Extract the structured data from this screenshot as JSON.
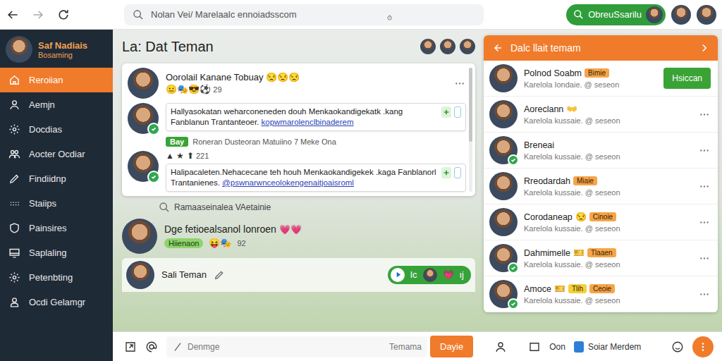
{
  "browser": {
    "address": "Nolan Vei/ Marelaalc ennoiadsscom",
    "action": "ObreuSsarilu"
  },
  "sidebar": {
    "user": {
      "name": "Saf Nadiais",
      "status": "Bosaming"
    },
    "items": [
      {
        "label": "Reroiian",
        "selected": true
      },
      {
        "label": "Aemjn",
        "selected": false
      },
      {
        "label": "Docdias",
        "selected": false
      },
      {
        "label": "Aocter Ocdiar",
        "selected": false
      },
      {
        "label": "Findiidnp",
        "selected": false
      },
      {
        "label": "Staiips",
        "selected": false
      },
      {
        "label": "Painsires",
        "selected": false
      },
      {
        "label": "Saplaling",
        "selected": false
      },
      {
        "label": "Petenbting",
        "selected": false
      },
      {
        "label": "Ocdi Gelamgr",
        "selected": false
      }
    ]
  },
  "feed": {
    "title": "La: Dat Teman",
    "thread": {
      "author": "Oorolail Kanane Tobuay",
      "author_emoji": "😒😒😒",
      "reactions": "😐🎭😎⚽",
      "reaction_count": "29",
      "messages": [
        {
          "online": true,
          "text": "Hallyasokatan weharconeneden douh Menkaokandigekatk .kang Fanblanun Trantanteoer.",
          "link": "kopwmarolenclbinaderem",
          "note": {
            "tag": "Bay",
            "text": "Roneran Dusteoran Matuiino 7 Meke Ona"
          }
        },
        {
          "online": true,
          "symbols": "▲ ★ ⬆",
          "count": "221",
          "text": "Halipacaleten.Nehacecane teh houh Menkaokandigekek .kaga Fanblanorl Trantanienes.",
          "link": "@pswnarwnceolokengenaitjoaisroml"
        }
      ]
    },
    "search_hint": "Ramaaseinalea VAetainie",
    "posts": [
      {
        "title": "Dge fetioealsanol lonroen",
        "emoji": "💗💗",
        "tag": "Hiienaon",
        "reactions": "😝🎭",
        "count": "92"
      }
    ],
    "friend": {
      "name": "Sali Teman",
      "controls": [
        "lc",
        "💗",
        "ıj"
      ]
    }
  },
  "friends_panel": {
    "title": "Dalc llait temam",
    "rows": [
      {
        "name": "Polnod Soabm",
        "tags": [
          {
            "text": "Bimie",
            "color": "#f6a54a"
          }
        ],
        "subtitle": "Karelola Iondaie. @ seseon",
        "online": false,
        "action": "Hsiccan"
      },
      {
        "name": "Aoreclann",
        "emoji": "👐",
        "tags": [],
        "subtitle": "Karelola kussaie. @ seseon",
        "online": false
      },
      {
        "name": "Breneai",
        "tags": [],
        "subtitle": "Karelola kussaie. @ seseon",
        "online": true
      },
      {
        "name": "Rreodardah",
        "tags": [
          {
            "text": "Miaie",
            "color": "#f6a54a"
          }
        ],
        "subtitle": "Karelola kussaie. @ seseon",
        "online": false
      },
      {
        "name": "Corodaneap",
        "emoji": "😒",
        "tags": [
          {
            "text": "Cinoie",
            "color": "#f6a54a"
          }
        ],
        "subtitle": "Karelola kussaie. @ seseon",
        "online": false
      },
      {
        "name": "Dahmimelle",
        "emoji": "🎫",
        "tags": [
          {
            "text": "Tlaaen",
            "color": "#f6a54a"
          }
        ],
        "subtitle": "Karelola kussaie. @ seseon",
        "online": true
      },
      {
        "name": "Amoce",
        "emoji": "🎫",
        "tags": [
          {
            "text": "Tlih",
            "color": "#f5d03a"
          },
          {
            "text": "Ceoie",
            "color": "#f6a54a"
          }
        ],
        "subtitle": "Karelola kussaie. @ seseon",
        "online": true
      }
    ]
  },
  "composer": {
    "placeholder": "Denmge",
    "hint": "Temama",
    "send": "Dayie",
    "status": "Oon",
    "link": "Soiar Merdem"
  }
}
